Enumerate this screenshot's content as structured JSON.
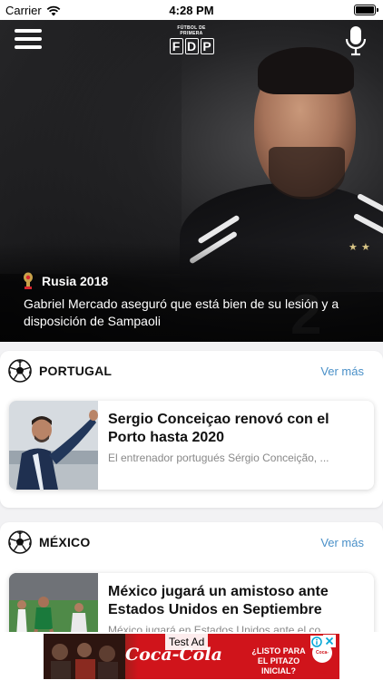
{
  "status_bar": {
    "carrier": "Carrier",
    "time": "4:28 PM"
  },
  "header": {
    "logo_top_text": "FÚTBOL DE PRIMERA",
    "logo_letters": [
      "F",
      "D",
      "P"
    ]
  },
  "hero": {
    "tag": "Rusia 2018",
    "headline": "Gabriel Mercado aseguró que está bien de su lesión y a disposición de Sampaoli",
    "jersey_number": "2"
  },
  "sections": [
    {
      "title": "PORTUGAL",
      "see_more": "Ver más",
      "articles": [
        {
          "title": "Sergio Conceiçao renovó con el Porto hasta 2020",
          "summary": "El entrenador portugués Sérgio Conceição, ..."
        }
      ]
    },
    {
      "title": "MÉXICO",
      "see_more": "Ver más",
      "articles": [
        {
          "title": "México jugará un amistoso ante Estados Unidos en Septiembre",
          "summary": "México jugará en Estados Unidos ante el co..."
        }
      ]
    }
  ],
  "ad": {
    "label": "Test Ad",
    "brand": "Coca-Cola",
    "text": "¿LISTO PARA EL PITAZO INICIAL?",
    "logo_text": "Coca-Cola"
  },
  "colors": {
    "accent_link": "#4a90c8",
    "ad_red": "#d0141b"
  }
}
